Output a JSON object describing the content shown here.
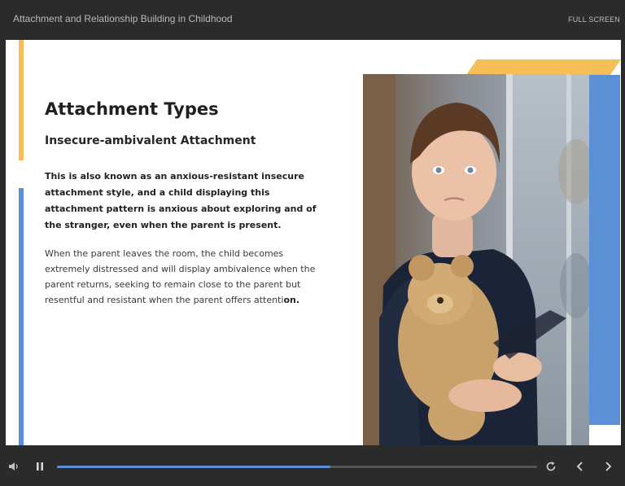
{
  "header": {
    "course_title": "Attachment and Relationship Building in Childhood",
    "fullscreen_label": "FULL SCREEN"
  },
  "slide": {
    "heading": "Attachment Types",
    "subheading": "Insecure-ambivalent Attachment",
    "bold_paragraph": "This is also known as an anxious-resistant insecure attachment style, and a child displaying this attachment pattern is anxious about exploring and of the stranger, even when the parent is present.",
    "paragraph_main": "When the parent leaves the room, the child becomes extremely distressed and will display ambivalence when the parent returns, seeking to remain close to the parent but resentful and resistant when the parent offers attenti",
    "paragraph_end": "on.",
    "accent_yellow": "#f6be57",
    "accent_blue": "#5b8fd6"
  },
  "player": {
    "progress": 0.57,
    "icons": [
      "volume-icon",
      "pause-icon",
      "replay-icon",
      "chevron-left-icon",
      "chevron-right-icon"
    ]
  }
}
